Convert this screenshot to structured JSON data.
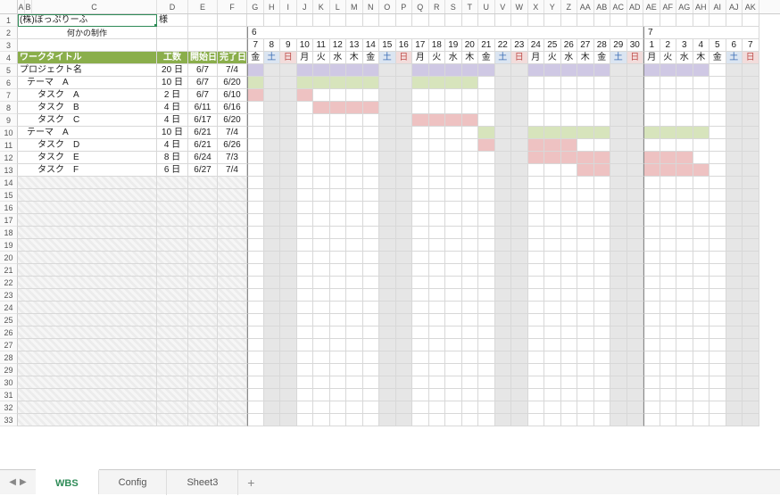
{
  "columns": [
    "A",
    "B",
    "C",
    "D",
    "E",
    "F",
    "G",
    "H",
    "I",
    "J",
    "K",
    "L",
    "M",
    "N",
    "O",
    "P",
    "Q",
    "R",
    "S",
    "T",
    "U",
    "V",
    "W",
    "X",
    "Y",
    "Z",
    "AA",
    "AB",
    "AC",
    "AD",
    "AE",
    "AF",
    "AG",
    "AH",
    "AI",
    "AJ",
    "AK"
  ],
  "months": {
    "m6": "6",
    "m7": "7"
  },
  "days": [
    7,
    8,
    9,
    10,
    11,
    12,
    13,
    14,
    15,
    16,
    17,
    18,
    19,
    20,
    21,
    22,
    23,
    24,
    25,
    26,
    27,
    28,
    29,
    30,
    1,
    2,
    3,
    4,
    5,
    6,
    7
  ],
  "dow": [
    "金",
    "土",
    "日",
    "月",
    "火",
    "水",
    "木",
    "金",
    "土",
    "日",
    "月",
    "火",
    "水",
    "木",
    "金",
    "土",
    "日",
    "月",
    "火",
    "水",
    "木",
    "金",
    "土",
    "日",
    "月",
    "火",
    "水",
    "木",
    "金",
    "土",
    "日"
  ],
  "dowClass": [
    "",
    "sat",
    "sun",
    "",
    "",
    "",
    "",
    "",
    "sat",
    "sun",
    "",
    "",
    "",
    "",
    "",
    "sat",
    "sun",
    "",
    "",
    "",
    "",
    "",
    "sat",
    "sun",
    "",
    "",
    "",
    "",
    "",
    "sat",
    "sun"
  ],
  "r1": {
    "company": "(株)ぽっぷりーふ",
    "sama": "様"
  },
  "r2": {
    "subtitle": "何かの制作"
  },
  "r4": {
    "title": "ワークタイトル",
    "kousu": "工数",
    "start": "開始日",
    "end": "完了日"
  },
  "tasks": [
    {
      "title": "プロジェクト名",
      "indent": 0,
      "days": "20 日",
      "start": "6/7",
      "end": "7/4",
      "color": "gPurple",
      "from": 0,
      "to": 27
    },
    {
      "title": "テーマ　A",
      "indent": 1,
      "days": "10 日",
      "start": "6/7",
      "end": "6/20",
      "color": "gGreen",
      "from": 0,
      "to": 13
    },
    {
      "title": "タスク　A",
      "indent": 2,
      "days": "2 日",
      "start": "6/7",
      "end": "6/10",
      "color": "gRed",
      "from": 0,
      "to": 3
    },
    {
      "title": "タスク　B",
      "indent": 2,
      "days": "4 日",
      "start": "6/11",
      "end": "6/16",
      "color": "gRed",
      "from": 4,
      "to": 9
    },
    {
      "title": "タスク　C",
      "indent": 2,
      "days": "4 日",
      "start": "6/17",
      "end": "6/20",
      "color": "gRed",
      "from": 10,
      "to": 13
    },
    {
      "title": "テーマ　A",
      "indent": 1,
      "days": "10 日",
      "start": "6/21",
      "end": "7/4",
      "color": "gGreen",
      "from": 14,
      "to": 27
    },
    {
      "title": "タスク　D",
      "indent": 2,
      "days": "4 日",
      "start": "6/21",
      "end": "6/26",
      "color": "gRed",
      "from": 14,
      "to": 19
    },
    {
      "title": "タスク　E",
      "indent": 2,
      "days": "8 日",
      "start": "6/24",
      "end": "7/3",
      "color": "gRed",
      "from": 17,
      "to": 26
    },
    {
      "title": "タスク　F",
      "indent": 2,
      "days": "6 日",
      "start": "6/27",
      "end": "7/4",
      "color": "gRed",
      "from": 20,
      "to": 27
    }
  ],
  "sheetTabs": [
    "WBS",
    "Config",
    "Sheet3"
  ],
  "activeTab": 0,
  "chart_data": {
    "type": "gantt",
    "title": "プロジェクト名",
    "date_range_start": "6/7",
    "date_range_end": "7/7",
    "tasks": [
      {
        "name": "プロジェクト名",
        "duration_days": 20,
        "start": "6/7",
        "end": "7/4",
        "group": "project"
      },
      {
        "name": "テーマ A",
        "duration_days": 10,
        "start": "6/7",
        "end": "6/20",
        "group": "theme"
      },
      {
        "name": "タスク A",
        "duration_days": 2,
        "start": "6/7",
        "end": "6/10",
        "group": "task"
      },
      {
        "name": "タスク B",
        "duration_days": 4,
        "start": "6/11",
        "end": "6/16",
        "group": "task"
      },
      {
        "name": "タスク C",
        "duration_days": 4,
        "start": "6/17",
        "end": "6/20",
        "group": "task"
      },
      {
        "name": "テーマ A",
        "duration_days": 10,
        "start": "6/21",
        "end": "7/4",
        "group": "theme"
      },
      {
        "name": "タスク D",
        "duration_days": 4,
        "start": "6/21",
        "end": "6/26",
        "group": "task"
      },
      {
        "name": "タスク E",
        "duration_days": 8,
        "start": "6/24",
        "end": "7/3",
        "group": "task"
      },
      {
        "name": "タスク F",
        "duration_days": 6,
        "start": "6/27",
        "end": "7/4",
        "group": "task"
      }
    ]
  }
}
